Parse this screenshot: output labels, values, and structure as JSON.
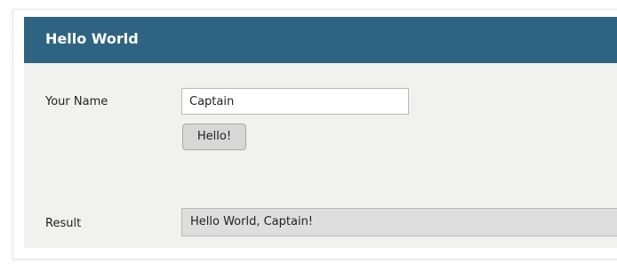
{
  "panel": {
    "title": "Hello World"
  },
  "form": {
    "name_label": "Your Name",
    "name_value": "Captain",
    "button_label": "Hello!",
    "result_label": "Result",
    "result_value": "Hello World, Captain!"
  },
  "colors": {
    "header": "#2e6482",
    "panel_background": "#f1f1f0",
    "button_background": "#d7d7d7",
    "result_background": "#dedede"
  }
}
